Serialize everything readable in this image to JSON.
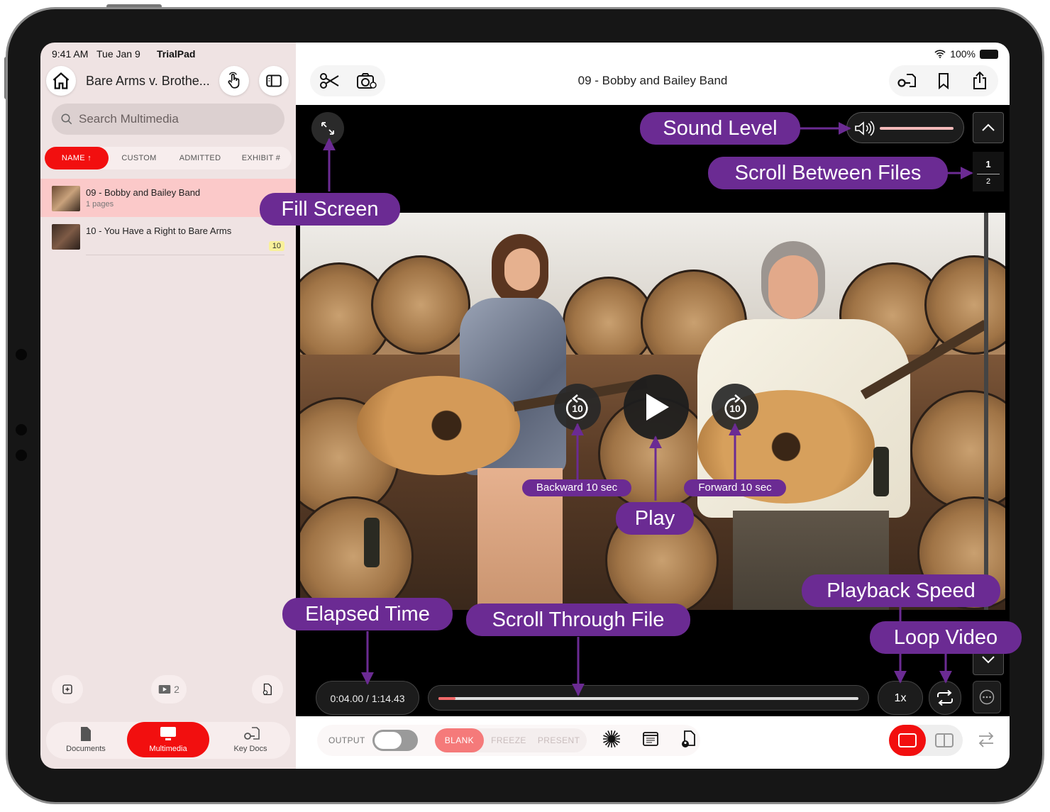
{
  "status": {
    "time": "9:41 AM",
    "date": "Tue Jan 9",
    "app": "TrialPad",
    "battery": "100%"
  },
  "sidebar": {
    "case_title": "Bare Arms v. Brothe...",
    "search_placeholder": "Search Multimedia",
    "sort_tabs": [
      {
        "label": "NAME ↑",
        "active": true
      },
      {
        "label": "CUSTOM",
        "active": false
      },
      {
        "label": "ADMITTED",
        "active": false
      },
      {
        "label": "EXHIBIT #",
        "active": false
      }
    ],
    "files": [
      {
        "name": "09 - Bobby and Bailey Band",
        "sub": "1 pages",
        "selected": true
      },
      {
        "name": "10 - You Have a Right to Bare Arms",
        "badge": "10",
        "selected": false
      }
    ],
    "video_count": "2",
    "nav": [
      {
        "label": "Documents",
        "icon": "document-icon"
      },
      {
        "label": "Multimedia",
        "icon": "monitor-icon",
        "active": true
      },
      {
        "label": "Key Docs",
        "icon": "key-doc-icon"
      }
    ]
  },
  "header": {
    "title": "09 - Bobby and Bailey Band"
  },
  "player": {
    "elapsed": "0:04.00 / 1:14.43",
    "progress": 0.04,
    "speed": "1x",
    "page_current": "1",
    "page_total": "2",
    "skip_seconds": "10"
  },
  "output_bar": {
    "output_label": "OUTPUT",
    "modes": [
      "BLANK",
      "FREEZE",
      "PRESENT"
    ]
  },
  "annotations": {
    "sound_level": "Sound Level",
    "scroll_between_files": "Scroll Between Files",
    "fill_screen": "Fill Screen",
    "backward": "Backward 10 sec",
    "forward": "Forward 10 sec",
    "play": "Play",
    "playback_speed": "Playback Speed",
    "elapsed_time": "Elapsed Time",
    "scroll_through_file": "Scroll Through File",
    "loop_video": "Loop Video"
  },
  "colors": {
    "accent": "#f20f0f",
    "annotation": "#6b2b93"
  }
}
